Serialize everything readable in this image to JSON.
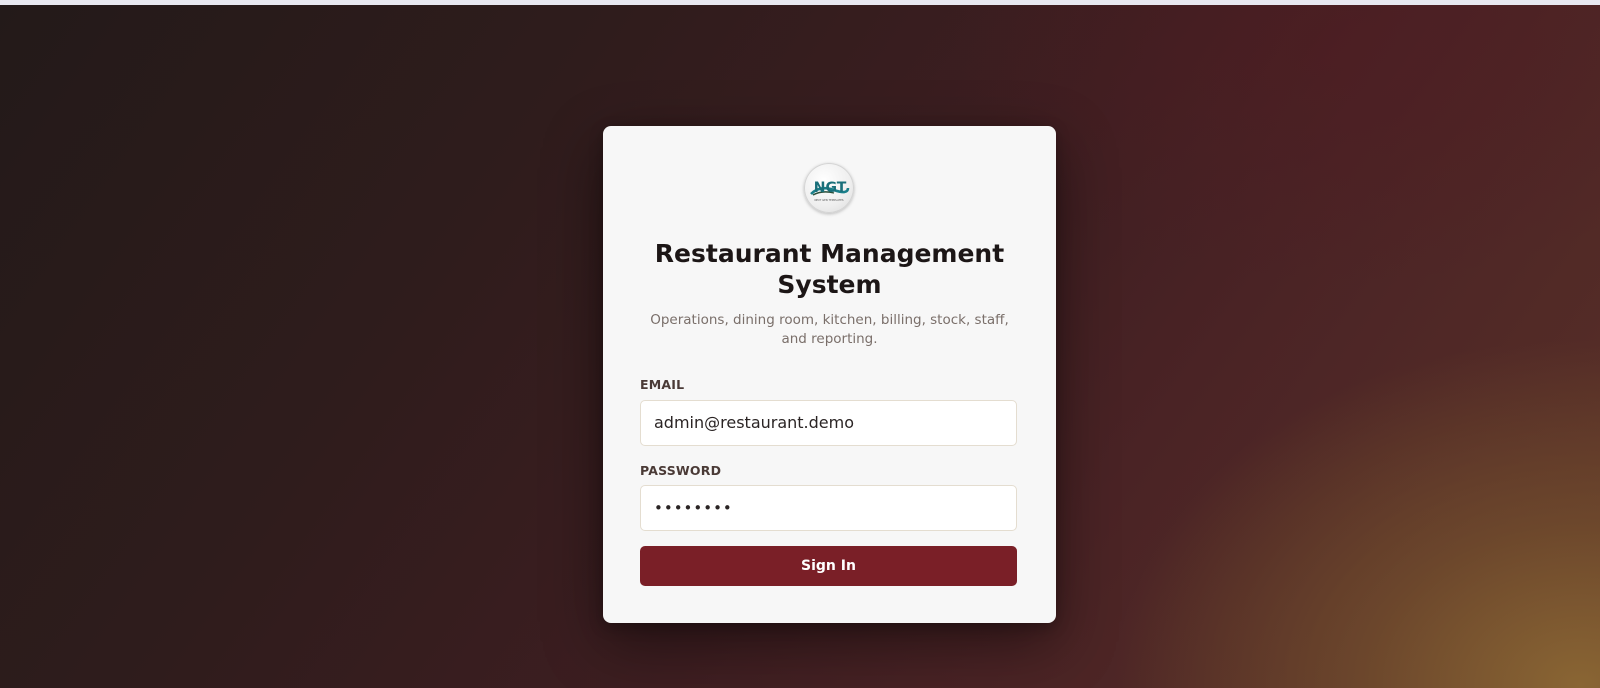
{
  "login": {
    "logo_text": "NGT",
    "logo_tagline": "NEXT GEN TEMPLATES",
    "title": "Restaurant Management System",
    "subtitle": "Operations, dining room, kitchen, billing, stock, staff, and reporting.",
    "email_label": "EMAIL",
    "email_value": "admin@restaurant.demo",
    "password_label": "PASSWORD",
    "password_value": "••••••••",
    "submit_label": "Sign In"
  },
  "colors": {
    "primary": "#7a1f27",
    "card_bg": "#f7f7f7",
    "logo_teal": "#1a7f8a"
  }
}
